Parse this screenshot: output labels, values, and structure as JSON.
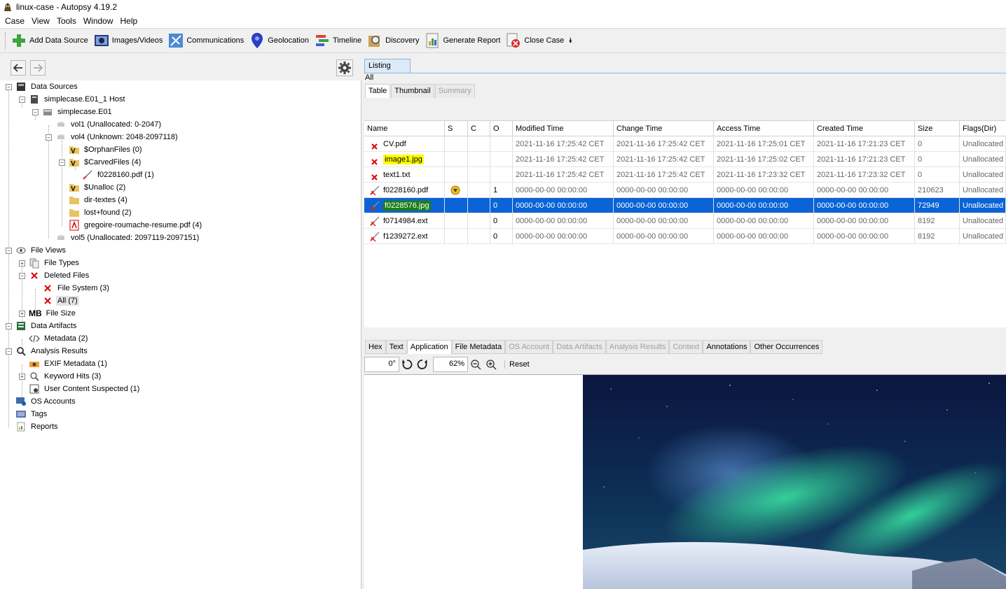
{
  "window": {
    "title": "linux-case - Autopsy 4.19.2"
  },
  "menu": [
    "Case",
    "View",
    "Tools",
    "Window",
    "Help"
  ],
  "toolbar": {
    "buttons": [
      {
        "label": "Add Data Source",
        "icon": "add-icon"
      },
      {
        "label": "Images/Videos",
        "icon": "images-videos-icon"
      },
      {
        "label": "Communications",
        "icon": "communications-icon"
      },
      {
        "label": "Geolocation",
        "icon": "geolocation-pin-icon"
      },
      {
        "label": "Timeline",
        "icon": "timeline-icon"
      },
      {
        "label": "Discovery",
        "icon": "discovery-icon"
      },
      {
        "label": "Generate Report",
        "icon": "report-icon"
      },
      {
        "label": "Close Case",
        "icon": "close-case-icon"
      }
    ]
  },
  "tree": {
    "data_sources": "Data Sources",
    "host": "simplecase.E01_1 Host",
    "image": "simplecase.E01",
    "vol1": "vol1 (Unallocated: 0-2047)",
    "vol4": "vol4 (Unknown: 2048-2097118)",
    "orphan": "$OrphanFiles (0)",
    "carved": "$CarvedFiles (4)",
    "carved_child": "f0228160.pdf (1)",
    "unalloc": "$Unalloc (2)",
    "dirtextes": "dir-textes (4)",
    "lostfound": "lost+found (2)",
    "resume": "gregoire-roumache-resume.pdf (4)",
    "vol5": "vol5 (Unallocated: 2097119-2097151)",
    "file_views": "File Views",
    "file_types": "File Types",
    "deleted_files": "Deleted Files",
    "file_system": "File System (3)",
    "all": "All (7)",
    "file_size_prefix": "MB",
    "file_size": "File Size",
    "data_artifacts": "Data Artifacts",
    "metadata": "Metadata (2)",
    "analysis_results": "Analysis Results",
    "exif": "EXIF Metadata (1)",
    "keyword": "Keyword Hits (3)",
    "user_content": "User Content Suspected (1)",
    "os_accounts": "OS Accounts",
    "tags": "Tags",
    "reports": "Reports"
  },
  "listing": {
    "tab": "Listing",
    "breadcrumb": "All",
    "subtabs": [
      "Table",
      "Thumbnail",
      "Summary"
    ],
    "columns": [
      "Name",
      "S",
      "C",
      "O",
      "Modified Time",
      "Change Time",
      "Access Time",
      "Created Time",
      "Size",
      "Flags(Dir)"
    ],
    "rows": [
      {
        "name": "CV.pdf",
        "s": "",
        "c": "",
        "o": "",
        "mod": "2021-11-16 17:25:42 CET",
        "chg": "2021-11-16 17:25:42 CET",
        "acc": "2021-11-16 17:25:01 CET",
        "crt": "2021-11-16 17:21:23 CET",
        "size": "0",
        "flags": "Unallocated"
      },
      {
        "name": "image1.jpg",
        "s": "",
        "c": "",
        "o": "",
        "mod": "2021-11-16 17:25:42 CET",
        "chg": "2021-11-16 17:25:42 CET",
        "acc": "2021-11-16 17:25:02 CET",
        "crt": "2021-11-16 17:21:23 CET",
        "size": "0",
        "flags": "Unallocated"
      },
      {
        "name": "text1.txt",
        "s": "",
        "c": "",
        "o": "",
        "mod": "2021-11-16 17:25:42 CET",
        "chg": "2021-11-16 17:25:42 CET",
        "acc": "2021-11-16 17:23:32 CET",
        "crt": "2021-11-16 17:23:32 CET",
        "size": "0",
        "flags": "Unallocated"
      },
      {
        "name": "f0228160.pdf",
        "s": "",
        "c": "",
        "o": "1",
        "mod": "0000-00-00 00:00:00",
        "chg": "0000-00-00 00:00:00",
        "acc": "0000-00-00 00:00:00",
        "crt": "0000-00-00 00:00:00",
        "size": "210623",
        "flags": "Unallocated"
      },
      {
        "name": "f0228576.jpg",
        "s": "",
        "c": "",
        "o": "0",
        "mod": "0000-00-00 00:00:00",
        "chg": "0000-00-00 00:00:00",
        "acc": "0000-00-00 00:00:00",
        "crt": "0000-00-00 00:00:00",
        "size": "72949",
        "flags": "Unallocated"
      },
      {
        "name": "f0714984.ext",
        "s": "",
        "c": "",
        "o": "0",
        "mod": "0000-00-00 00:00:00",
        "chg": "0000-00-00 00:00:00",
        "acc": "0000-00-00 00:00:00",
        "crt": "0000-00-00 00:00:00",
        "size": "8192",
        "flags": "Unallocated"
      },
      {
        "name": "f1239272.ext",
        "s": "",
        "c": "",
        "o": "0",
        "mod": "0000-00-00 00:00:00",
        "chg": "0000-00-00 00:00:00",
        "acc": "0000-00-00 00:00:00",
        "crt": "0000-00-00 00:00:00",
        "size": "8192",
        "flags": "Unallocated"
      }
    ]
  },
  "content_viewer": {
    "tabs": [
      "Hex",
      "Text",
      "Application",
      "File Metadata",
      "OS Account",
      "Data Artifacts",
      "Analysis Results",
      "Context",
      "Annotations",
      "Other Occurrences"
    ],
    "rotation": "0°",
    "zoom": "62%",
    "reset": "Reset"
  }
}
